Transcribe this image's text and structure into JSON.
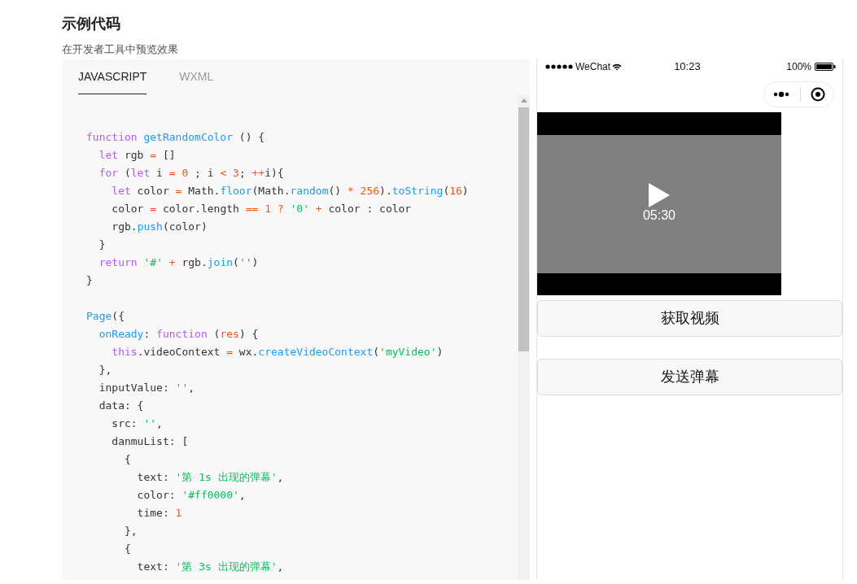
{
  "heading": "示例代码",
  "subtitle": "在开发者工具中预览效果",
  "tabs": [
    {
      "label": "JAVASCRIPT",
      "selected": true
    },
    {
      "label": "WXML",
      "selected": false
    }
  ],
  "code_lines": [
    {
      "kind": "code",
      "tokens": [
        {
          "kind": "keyword",
          "text": "function"
        },
        {
          "kind": "func",
          "text": " getRandomColor"
        },
        {
          "kind": "plain",
          "text": " () {"
        }
      ]
    },
    {
      "kind": "code",
      "tokens": [
        {
          "kind": "keyword",
          "text": "  let"
        },
        {
          "kind": "plain",
          "text": " rgb "
        },
        {
          "kind": "literal",
          "text": "="
        },
        {
          "kind": "plain",
          "text": " []"
        }
      ]
    },
    {
      "kind": "code",
      "tokens": [
        {
          "kind": "keyword",
          "text": "  for"
        },
        {
          "kind": "plain",
          "text": " ("
        },
        {
          "kind": "keyword",
          "text": "let"
        },
        {
          "kind": "plain",
          "text": " i "
        },
        {
          "kind": "literal",
          "text": "= 0"
        },
        {
          "kind": "plain",
          "text": " ; i "
        },
        {
          "kind": "literal",
          "text": "< 3"
        },
        {
          "kind": "plain",
          "text": "; "
        },
        {
          "kind": "literal",
          "text": "++"
        },
        {
          "kind": "plain",
          "text": "i){"
        }
      ]
    },
    {
      "kind": "code",
      "tokens": [
        {
          "kind": "keyword",
          "text": "    let"
        },
        {
          "kind": "plain",
          "text": " color "
        },
        {
          "kind": "literal",
          "text": "="
        },
        {
          "kind": "plain",
          "text": " Math."
        },
        {
          "kind": "func",
          "text": "floor"
        },
        {
          "kind": "plain",
          "text": "(Math."
        },
        {
          "kind": "func",
          "text": "random"
        },
        {
          "kind": "plain",
          "text": "() "
        },
        {
          "kind": "literal",
          "text": "* 256"
        },
        {
          "kind": "plain",
          "text": ")."
        },
        {
          "kind": "func",
          "text": "toString"
        },
        {
          "kind": "plain",
          "text": "("
        },
        {
          "kind": "literal",
          "text": "16"
        },
        {
          "kind": "plain",
          "text": ")"
        }
      ]
    },
    {
      "kind": "code",
      "tokens": [
        {
          "kind": "plain",
          "text": "    color "
        },
        {
          "kind": "literal",
          "text": "="
        },
        {
          "kind": "plain",
          "text": " color.length "
        },
        {
          "kind": "literal",
          "text": "== 1 ?"
        },
        {
          "kind": "string",
          "text": " '0'"
        },
        {
          "kind": "literal",
          "text": " +"
        },
        {
          "kind": "plain",
          "text": " color : color"
        }
      ]
    },
    {
      "kind": "code",
      "tokens": [
        {
          "kind": "plain",
          "text": "    rgb."
        },
        {
          "kind": "func",
          "text": "push"
        },
        {
          "kind": "plain",
          "text": "(color)"
        }
      ]
    },
    {
      "kind": "code",
      "tokens": [
        {
          "kind": "plain",
          "text": "  }"
        }
      ]
    },
    {
      "kind": "code",
      "tokens": [
        {
          "kind": "keyword",
          "text": "  return"
        },
        {
          "kind": "string",
          "text": " '#'"
        },
        {
          "kind": "literal",
          "text": " +"
        },
        {
          "kind": "plain",
          "text": " rgb."
        },
        {
          "kind": "func",
          "text": "join"
        },
        {
          "kind": "plain",
          "text": "("
        },
        {
          "kind": "string",
          "text": "''"
        },
        {
          "kind": "plain",
          "text": ")"
        }
      ]
    },
    {
      "kind": "code",
      "tokens": [
        {
          "kind": "plain",
          "text": "}"
        }
      ]
    },
    {
      "kind": "blank"
    },
    {
      "kind": "code",
      "tokens": [
        {
          "kind": "func",
          "text": "Page"
        },
        {
          "kind": "plain",
          "text": "({"
        }
      ]
    },
    {
      "kind": "code",
      "tokens": [
        {
          "kind": "func",
          "text": "  onReady"
        },
        {
          "kind": "plain",
          "text": ": "
        },
        {
          "kind": "keyword",
          "text": "function"
        },
        {
          "kind": "plain",
          "text": " ("
        },
        {
          "kind": "literal",
          "text": "res"
        },
        {
          "kind": "plain",
          "text": ") {"
        }
      ]
    },
    {
      "kind": "code",
      "tokens": [
        {
          "kind": "keyword",
          "text": "    this"
        },
        {
          "kind": "plain",
          "text": ".videoContext "
        },
        {
          "kind": "literal",
          "text": "="
        },
        {
          "kind": "plain",
          "text": " wx."
        },
        {
          "kind": "func",
          "text": "createVideoContext"
        },
        {
          "kind": "plain",
          "text": "("
        },
        {
          "kind": "string",
          "text": "'myVideo'"
        },
        {
          "kind": "plain",
          "text": ")"
        }
      ]
    },
    {
      "kind": "code",
      "tokens": [
        {
          "kind": "plain",
          "text": "  },"
        }
      ]
    },
    {
      "kind": "code",
      "tokens": [
        {
          "kind": "plain",
          "text": "  inputValue: "
        },
        {
          "kind": "string",
          "text": "''"
        },
        {
          "kind": "plain",
          "text": ","
        }
      ]
    },
    {
      "kind": "code",
      "tokens": [
        {
          "kind": "plain",
          "text": "  data: {"
        }
      ]
    },
    {
      "kind": "code",
      "tokens": [
        {
          "kind": "plain",
          "text": "    src: "
        },
        {
          "kind": "string",
          "text": "''"
        },
        {
          "kind": "plain",
          "text": ","
        }
      ]
    },
    {
      "kind": "code",
      "tokens": [
        {
          "kind": "plain",
          "text": "    danmuList: ["
        }
      ]
    },
    {
      "kind": "code",
      "tokens": [
        {
          "kind": "plain",
          "text": "      {"
        }
      ]
    },
    {
      "kind": "code",
      "tokens": [
        {
          "kind": "plain",
          "text": "        text: "
        },
        {
          "kind": "string",
          "text": "'第 1s 出现的弹幕'"
        },
        {
          "kind": "plain",
          "text": ","
        }
      ]
    },
    {
      "kind": "code",
      "tokens": [
        {
          "kind": "plain",
          "text": "        color: "
        },
        {
          "kind": "string",
          "text": "'#ff0000'"
        },
        {
          "kind": "plain",
          "text": ","
        }
      ]
    },
    {
      "kind": "code",
      "tokens": [
        {
          "kind": "plain",
          "text": "        time: "
        },
        {
          "kind": "literal",
          "text": "1"
        }
      ]
    },
    {
      "kind": "code",
      "tokens": [
        {
          "kind": "plain",
          "text": "      },"
        }
      ]
    },
    {
      "kind": "code",
      "tokens": [
        {
          "kind": "plain",
          "text": "      {"
        }
      ]
    },
    {
      "kind": "code",
      "tokens": [
        {
          "kind": "plain",
          "text": "        text: "
        },
        {
          "kind": "string",
          "text": "'第 3s 出现的弹幕'"
        },
        {
          "kind": "plain",
          "text": ","
        }
      ]
    }
  ],
  "phone": {
    "status_bar": {
      "carrier": "WeChat",
      "time": "10:23",
      "battery": "100%"
    },
    "video": {
      "duration": "05:30"
    },
    "buttons": [
      "获取视频",
      "发送弹幕"
    ]
  }
}
